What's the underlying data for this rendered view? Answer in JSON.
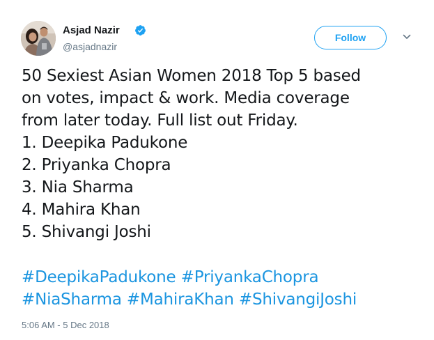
{
  "author": {
    "display_name": "Asjad Nazir",
    "handle": "@asjadnazir",
    "verified": true,
    "avatar_icon": "profile-photo"
  },
  "follow_button": {
    "label": "Follow",
    "color": "#1da1f2"
  },
  "menu_icon": "chevron-down-icon",
  "tweet": {
    "lines": [
      "50 Sexiest Asian Women 2018 Top 5 based",
      "on votes, impact & work. Media coverage",
      "from later today. Full list out Friday.",
      "1. Deepika Padukone",
      "2. Priyanka Chopra",
      "3. Nia Sharma",
      "4. Mahira Khan",
      "5. Shivangi Joshi"
    ],
    "hashtag_rows": [
      [
        "#DeepikaPadukone",
        "#PriyankaChopra"
      ],
      [
        "#NiaSharma",
        "#MahiraKhan",
        "#ShivangiJoshi"
      ]
    ],
    "hashtag_color": "#1b95e0",
    "timestamp": "5:06 AM - 5 Dec 2018"
  }
}
